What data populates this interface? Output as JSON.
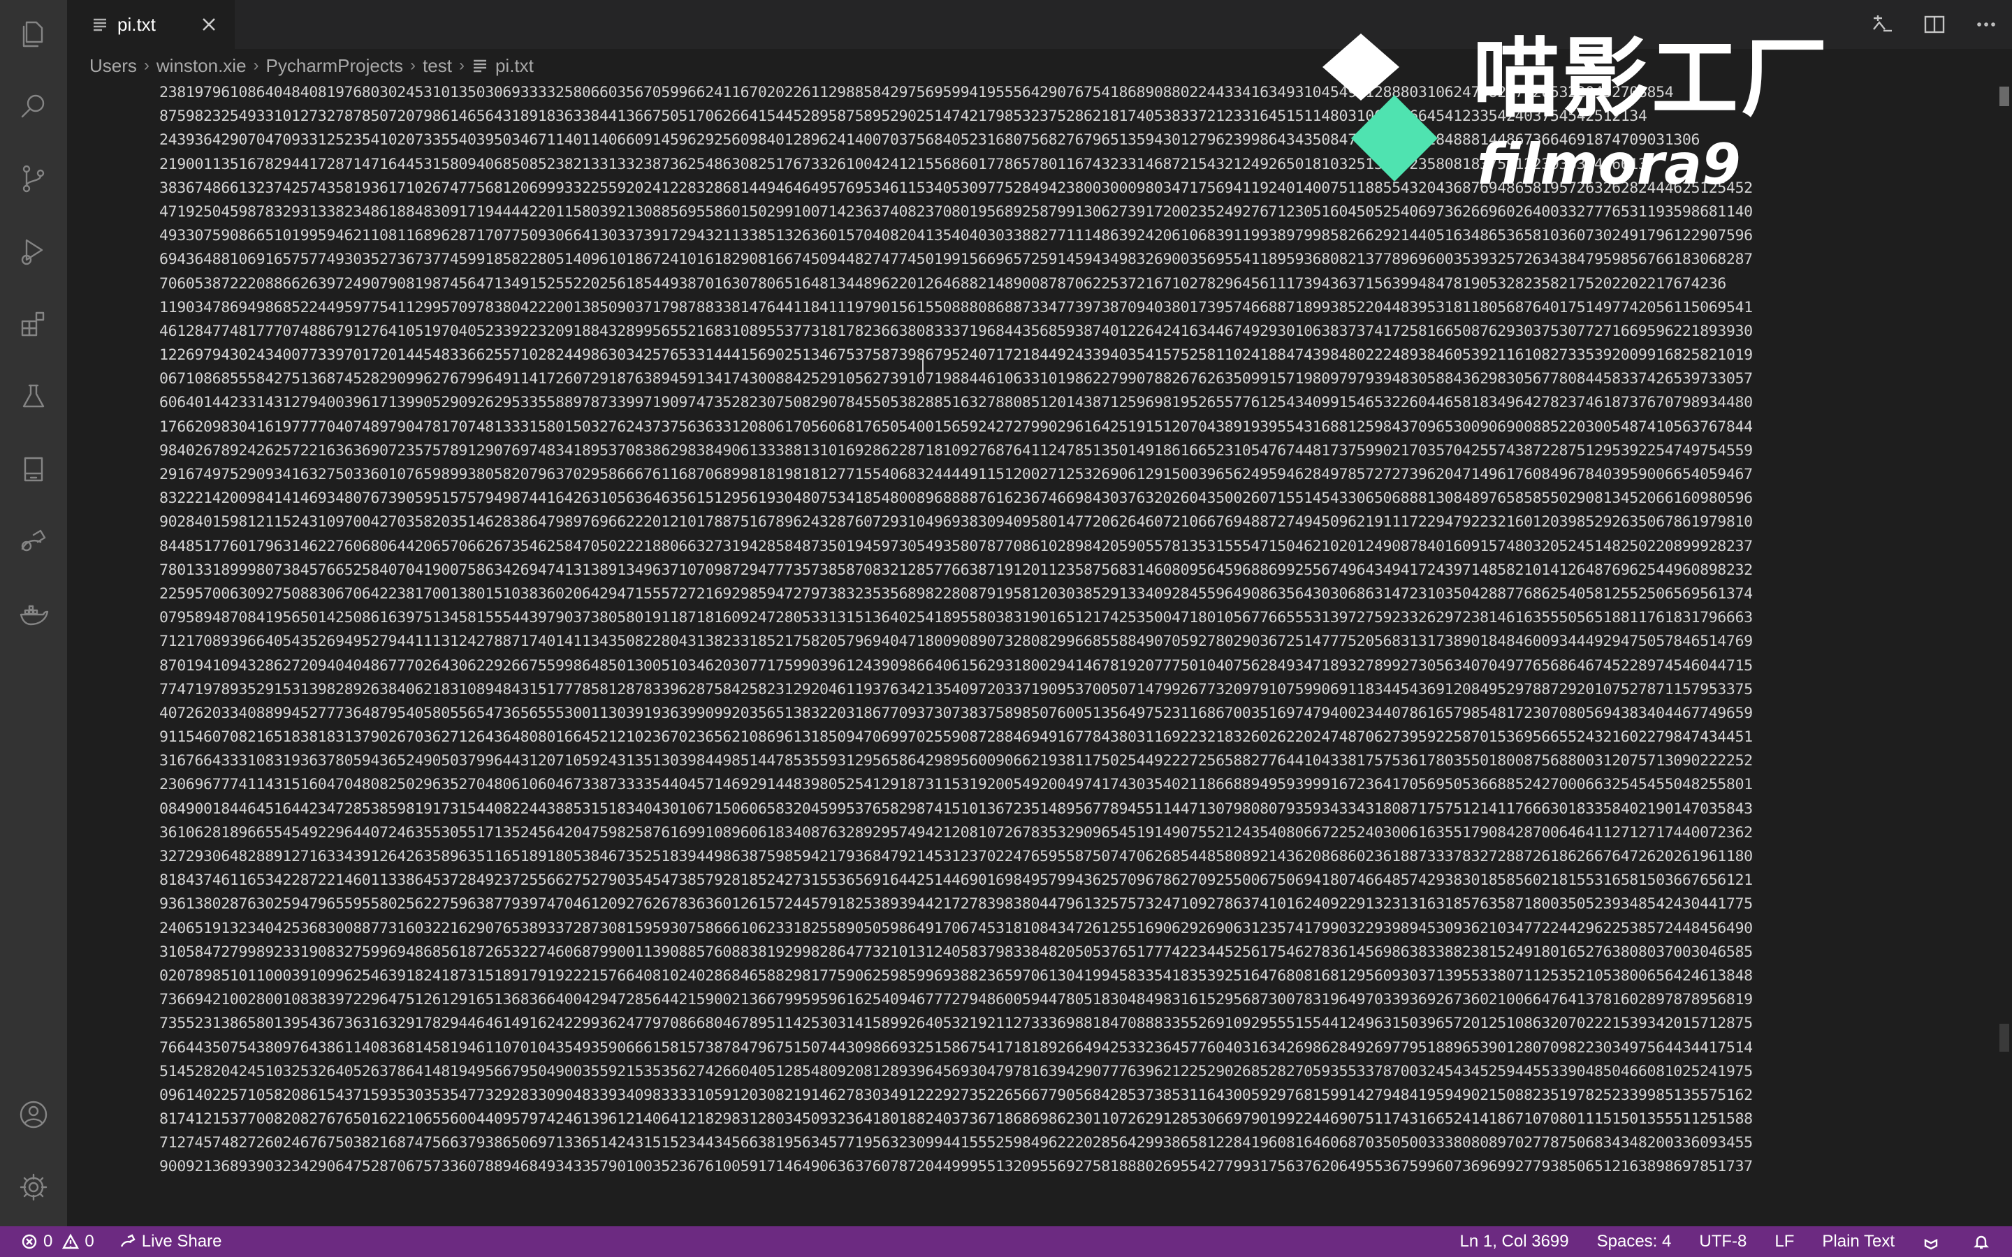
{
  "tab": {
    "label": "pi.txt"
  },
  "breadcrumb": [
    "Users",
    "winston.xie",
    "PycharmProjects",
    "test",
    "pi.txt"
  ],
  "watermark": {
    "cn": "喵影工厂",
    "en": "filmora9"
  },
  "status": {
    "errors": "0",
    "warnings": "0",
    "live_share": "Live Share",
    "position": "Ln 1, Col 3699",
    "spaces": "Spaces: 4",
    "encoding": "UTF-8",
    "eol": "LF",
    "language": "Plain Text"
  },
  "activity_icons": [
    "explorer-icon",
    "search-icon",
    "source-control-icon",
    "run-debug-icon",
    "extensions-icon",
    "testing-icon",
    "notebook-icon",
    "live-share-icon",
    "docker-icon",
    "account-icon",
    "settings-gear-icon"
  ],
  "colors": {
    "status_bar": "#6c2a81",
    "editor_bg": "#1e1e1e",
    "activity_bar": "#333333",
    "watermark_green": "#4fe3b0"
  },
  "lines": [
    "2381979610864048408197680302453101350306933332580660356705996624116702022611298858429756959941955564290767541868908802244334163493104549512888031062479828712653220492708854",
    "8759823254933101273278785072079861465643189183633844136675051706266415445289587589529025147421798532375286218174053833721233164515114803106395664541233542403754542512134",
    "2439364290704709331252354102073355403950346711401140660914596292560984012896241400703756840523168075682767965135943012796239986434350847335371982848881448673664691874709031306",
    "2190011351678294417287147164453158094068508523821331332387362548630825176733261004241215568601778657801167432331468721543212492650181032513293235808183756122393039446613",
    "3836748661323742574358193617102674775681206999332255920241228328681449464649576953461153405309775284942380030009803471756941192401400751188554320436876948658195726326282444625125452",
    "4719250459878329313382348618848309171944442201158039213088569558601502991007142363740823708019568925879913062739172002352492767123051604505254069736266960264003327776531193598681140",
    "4933075908665101995946211081168962871707750930664130337391729432113385132636015704082041354040303388277111486392420610683911993897998582662921440516348653658103607302491796122907596",
    "6943648810691657577493035273673774599185822805140961018672410161829081667450944827477450199156696572591459434983269003569554118959368082137789696003539325726343847959856766183068287",
    "7060538722208866263972490790819874564713491525522025618544938701630780651648134489622012646882148900878706225372167102782964561117394363715639948478190532823582175202202217674236",
    "1190347869498685224495977541129957097838042220013850903717987883381476441184111979015615508880868873347739738709403801739574668871899385220448395318118056876401751497742056115069541",
    "4612847748177707488679127641051970405233922320918843289956552168310895537731817823663808333719684435685938740122642416344674929301063837374172581665087629303753077271669596221893930",
    "1226979430243400773397017201445483366255710282449863034257653314441569025134675375873986795240717218449243394035415752581102418847439848022248938460539211610827335392009916825821019",
    "0671086855584275136874528290996276799649114172607291876389459134174300884252910562739107198844610633101986227990788267626350991571980979793948305884362983056778084458337426539733057",
    "6064014423314312794003961713990529092629533558897873399719097473528230750829078455053828851632788085120143871259698195265577612543409915465322604465818349642782374618737670798934480",
    "1766209830416197777040748979047817074813331580150327624373756363312080617056068176505400156592427279902961642519151207043891939554316881259843709653009069008852203005487410563767844",
    "9840267892426257221636369072357578912907697483418953708386298384906133388131016928622871810927687641124785135014918616652310547674481737599021703570425574387228751295392254749754559",
    "2916749752909341632750336010765989938058207963702958666761168706899818198181277155406832444491151200271253269061291500396562495946284978572727396204714961760849678403959006654059467",
    "8322214200984141469348076739059515757949874416426310563646356151295619304807534185480089688887616236746698430376320260435002607155145433065068881308489765858550290813452066160980596",
    "9028401598121152431097004270358203514628386479897696622201210178875167896243287607293104969383094095801477206264607210667694887274945096219111722947922321601203985292635067861979810",
    "8448517760179631462276068064420657066267354625847050222188066327319428584873501945973054935807877086102898420590557813531555471504621020124908784016091574803205245148250220899928237",
    "7801331899980738457665258407041900758634269474131389134963710709872947773573858708321285776638719120112358756831460809564596886992556749643494172439714858210141264876962544960898232",
    "2259570063092750883067064223817001380151038360206429471555727216929859472797383235356898228087919581203038529133409284559649086356430306863147231035042887768625405812552506569561374",
    "0795894870841956501425086163975134581555443979037380580191187181609247280533131513640254189558038319016512174253500471801056776655531397275923326297238146163555056518811761831796663",
    "7121708939664054352694952794411131242788717401411343508228043138233185217582057969404718009089073280829966855884907059278029036725147775205683131738901848460093444929475057846514769",
    "8701941094328627209404048677702643062292667559986485013005103462030771759903961243909866406156293180029414678192077750104075628493471893278992730563407049776568646745228974546044715",
    "7747197893529153139828926384062183108948431517778581287833962875842582312920461193763421354097203371909537005071479926773209791075990691183445436912084952978872920107527871157953375",
    "4072620334088994527773648795405805565473656555300113039193639909920356513832203186770937307383758985076005135649752311686700351697479400234407861657985481723070805694383404467749659",
    "9115460708216518381831379026703627126436480801664521210236702365621086961318509470699702559087288469491677843803116922321832602622024748706273959225870153695665524321602279847434451",
    "3167664333108319363780594365249050379964431207105924313513039844985144785355931295658642989560090662193811750254492227256588277644104338175753617803550180087568800312075713090222252",
    "2306967774114315160470480825029635270480610604673387333354404571469291448398052541291873115319200549200497417430354021186688949593999167236417056950536688524270006632545455048255801",
    "0849001844645164423472853859819173154408224438853151834043010671506065832045995376582987415101367235148956778945511447130798080793593433431808717575121411766630183358402190147035843",
    "3610628189665545492296440724635530551713524564204759825876169910896061834087632892957494212081072678353290965451914907552124354080667225240300616355179084287006464112712717440072362",
    "3272930648288912716334391264263589635116518918053846735251839449863875985942179368479214531237022476595587507470626854485808921436208686023618873337832728872618626676472620261961180",
    "8184374611653422872214601133864537284923725566275279035454738579281852427315536569164425144690169849579943625709678627092550067506941807466485742938301858560218155316581503667656121",
    "9361380287630259479655955802562275963877939747046120927626783636012615724457918253893944217278398380447961325757324710927863741016240922913231316318576358718003505239348542430441775",
    "2406519132340425368300887731603221629076538933728730815959307586661062331825589050598649170674531810843472612551690629269063123574179903229398945309362103477224429622538572448456490",
    "3105847279989233190832759969486856187265322746068799001139088576088381929982864773210131240583798338482050537651777422344525617546278361456986383388238152491801652763808037003046585",
    "0207898510110003910996254639182418731518917919222157664081024028684658829817759062598599693882365970613041994583354183539251647680816812956093037139553380711253521053800656424613848",
    "7366942100280010838397229647512612916513683664004294728564421590021366799595961625409467772794860059447805183048498316152956873007831964970339369267360210066476413781602897878956819",
    "7355231386580139543673631632917829446461491624229936247797086680467895114253031415899264053219211273336988184708883355269109295551554412496315039657201251086320702221539342015712875",
    "7664435075438097643861140836814581946110701043549359066615815738784796751507443098669325158675417181892664942533236457760403163426986284926977951889653901280709822303497564434417514",
    "5145282042451032532640526378641481949566795049003559215353562742660405128548092081289396456930479781639429077763962122529026852827059355337870032454345259445533904850466081025241975",
    "0961402257105820861543715935303535477329283309048339340983333105912030821914627830349122292735226566779056842853738531164300592976815991427948419594902150882351978252339985135575162",
    "8174121537700820827676501622106556004409579742461396121406412182983128034509323641801882403736718686986230110726291285306697901992244690751174316652414186710708011151501355511251588",
    "7127457482726024676750382168747566379386506971336514243151523443456638195634577195632309944155525984962220285642993865812284196081646068703505003338080897027787506834348200336093455",
    "9009213689390323429064752870675733607889468493433579010035236761005917146490636376078720449995513209556927581888026955427799317563762064955367599607369699277938506512163898697851737"
  ]
}
